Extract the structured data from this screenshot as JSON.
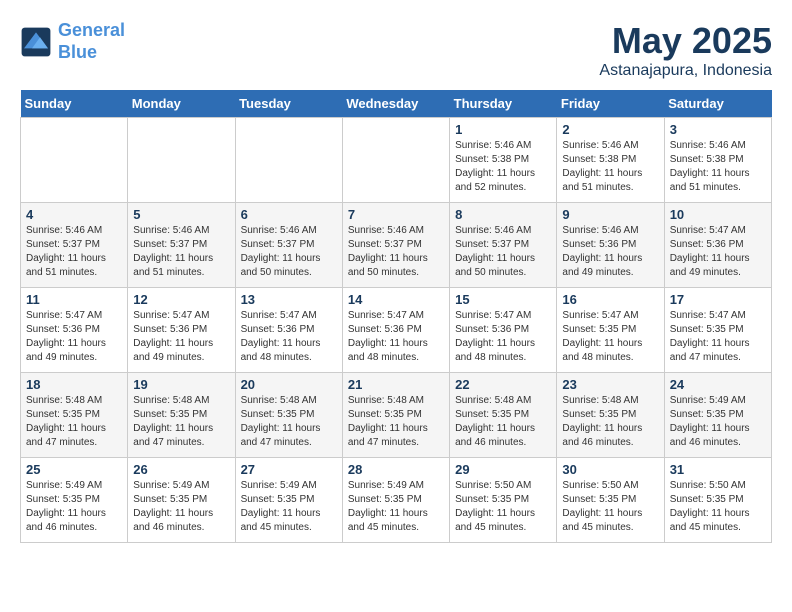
{
  "logo": {
    "line1": "General",
    "line2": "Blue"
  },
  "title": "May 2025",
  "subtitle": "Astanajapura, Indonesia",
  "days_of_week": [
    "Sunday",
    "Monday",
    "Tuesday",
    "Wednesday",
    "Thursday",
    "Friday",
    "Saturday"
  ],
  "weeks": [
    [
      {
        "day": "",
        "info": ""
      },
      {
        "day": "",
        "info": ""
      },
      {
        "day": "",
        "info": ""
      },
      {
        "day": "",
        "info": ""
      },
      {
        "day": "1",
        "info": "Sunrise: 5:46 AM\nSunset: 5:38 PM\nDaylight: 11 hours\nand 52 minutes."
      },
      {
        "day": "2",
        "info": "Sunrise: 5:46 AM\nSunset: 5:38 PM\nDaylight: 11 hours\nand 51 minutes."
      },
      {
        "day": "3",
        "info": "Sunrise: 5:46 AM\nSunset: 5:38 PM\nDaylight: 11 hours\nand 51 minutes."
      }
    ],
    [
      {
        "day": "4",
        "info": "Sunrise: 5:46 AM\nSunset: 5:37 PM\nDaylight: 11 hours\nand 51 minutes."
      },
      {
        "day": "5",
        "info": "Sunrise: 5:46 AM\nSunset: 5:37 PM\nDaylight: 11 hours\nand 51 minutes."
      },
      {
        "day": "6",
        "info": "Sunrise: 5:46 AM\nSunset: 5:37 PM\nDaylight: 11 hours\nand 50 minutes."
      },
      {
        "day": "7",
        "info": "Sunrise: 5:46 AM\nSunset: 5:37 PM\nDaylight: 11 hours\nand 50 minutes."
      },
      {
        "day": "8",
        "info": "Sunrise: 5:46 AM\nSunset: 5:37 PM\nDaylight: 11 hours\nand 50 minutes."
      },
      {
        "day": "9",
        "info": "Sunrise: 5:46 AM\nSunset: 5:36 PM\nDaylight: 11 hours\nand 49 minutes."
      },
      {
        "day": "10",
        "info": "Sunrise: 5:47 AM\nSunset: 5:36 PM\nDaylight: 11 hours\nand 49 minutes."
      }
    ],
    [
      {
        "day": "11",
        "info": "Sunrise: 5:47 AM\nSunset: 5:36 PM\nDaylight: 11 hours\nand 49 minutes."
      },
      {
        "day": "12",
        "info": "Sunrise: 5:47 AM\nSunset: 5:36 PM\nDaylight: 11 hours\nand 49 minutes."
      },
      {
        "day": "13",
        "info": "Sunrise: 5:47 AM\nSunset: 5:36 PM\nDaylight: 11 hours\nand 48 minutes."
      },
      {
        "day": "14",
        "info": "Sunrise: 5:47 AM\nSunset: 5:36 PM\nDaylight: 11 hours\nand 48 minutes."
      },
      {
        "day": "15",
        "info": "Sunrise: 5:47 AM\nSunset: 5:36 PM\nDaylight: 11 hours\nand 48 minutes."
      },
      {
        "day": "16",
        "info": "Sunrise: 5:47 AM\nSunset: 5:35 PM\nDaylight: 11 hours\nand 48 minutes."
      },
      {
        "day": "17",
        "info": "Sunrise: 5:47 AM\nSunset: 5:35 PM\nDaylight: 11 hours\nand 47 minutes."
      }
    ],
    [
      {
        "day": "18",
        "info": "Sunrise: 5:48 AM\nSunset: 5:35 PM\nDaylight: 11 hours\nand 47 minutes."
      },
      {
        "day": "19",
        "info": "Sunrise: 5:48 AM\nSunset: 5:35 PM\nDaylight: 11 hours\nand 47 minutes."
      },
      {
        "day": "20",
        "info": "Sunrise: 5:48 AM\nSunset: 5:35 PM\nDaylight: 11 hours\nand 47 minutes."
      },
      {
        "day": "21",
        "info": "Sunrise: 5:48 AM\nSunset: 5:35 PM\nDaylight: 11 hours\nand 47 minutes."
      },
      {
        "day": "22",
        "info": "Sunrise: 5:48 AM\nSunset: 5:35 PM\nDaylight: 11 hours\nand 46 minutes."
      },
      {
        "day": "23",
        "info": "Sunrise: 5:48 AM\nSunset: 5:35 PM\nDaylight: 11 hours\nand 46 minutes."
      },
      {
        "day": "24",
        "info": "Sunrise: 5:49 AM\nSunset: 5:35 PM\nDaylight: 11 hours\nand 46 minutes."
      }
    ],
    [
      {
        "day": "25",
        "info": "Sunrise: 5:49 AM\nSunset: 5:35 PM\nDaylight: 11 hours\nand 46 minutes."
      },
      {
        "day": "26",
        "info": "Sunrise: 5:49 AM\nSunset: 5:35 PM\nDaylight: 11 hours\nand 46 minutes."
      },
      {
        "day": "27",
        "info": "Sunrise: 5:49 AM\nSunset: 5:35 PM\nDaylight: 11 hours\nand 45 minutes."
      },
      {
        "day": "28",
        "info": "Sunrise: 5:49 AM\nSunset: 5:35 PM\nDaylight: 11 hours\nand 45 minutes."
      },
      {
        "day": "29",
        "info": "Sunrise: 5:50 AM\nSunset: 5:35 PM\nDaylight: 11 hours\nand 45 minutes."
      },
      {
        "day": "30",
        "info": "Sunrise: 5:50 AM\nSunset: 5:35 PM\nDaylight: 11 hours\nand 45 minutes."
      },
      {
        "day": "31",
        "info": "Sunrise: 5:50 AM\nSunset: 5:35 PM\nDaylight: 11 hours\nand 45 minutes."
      }
    ]
  ]
}
